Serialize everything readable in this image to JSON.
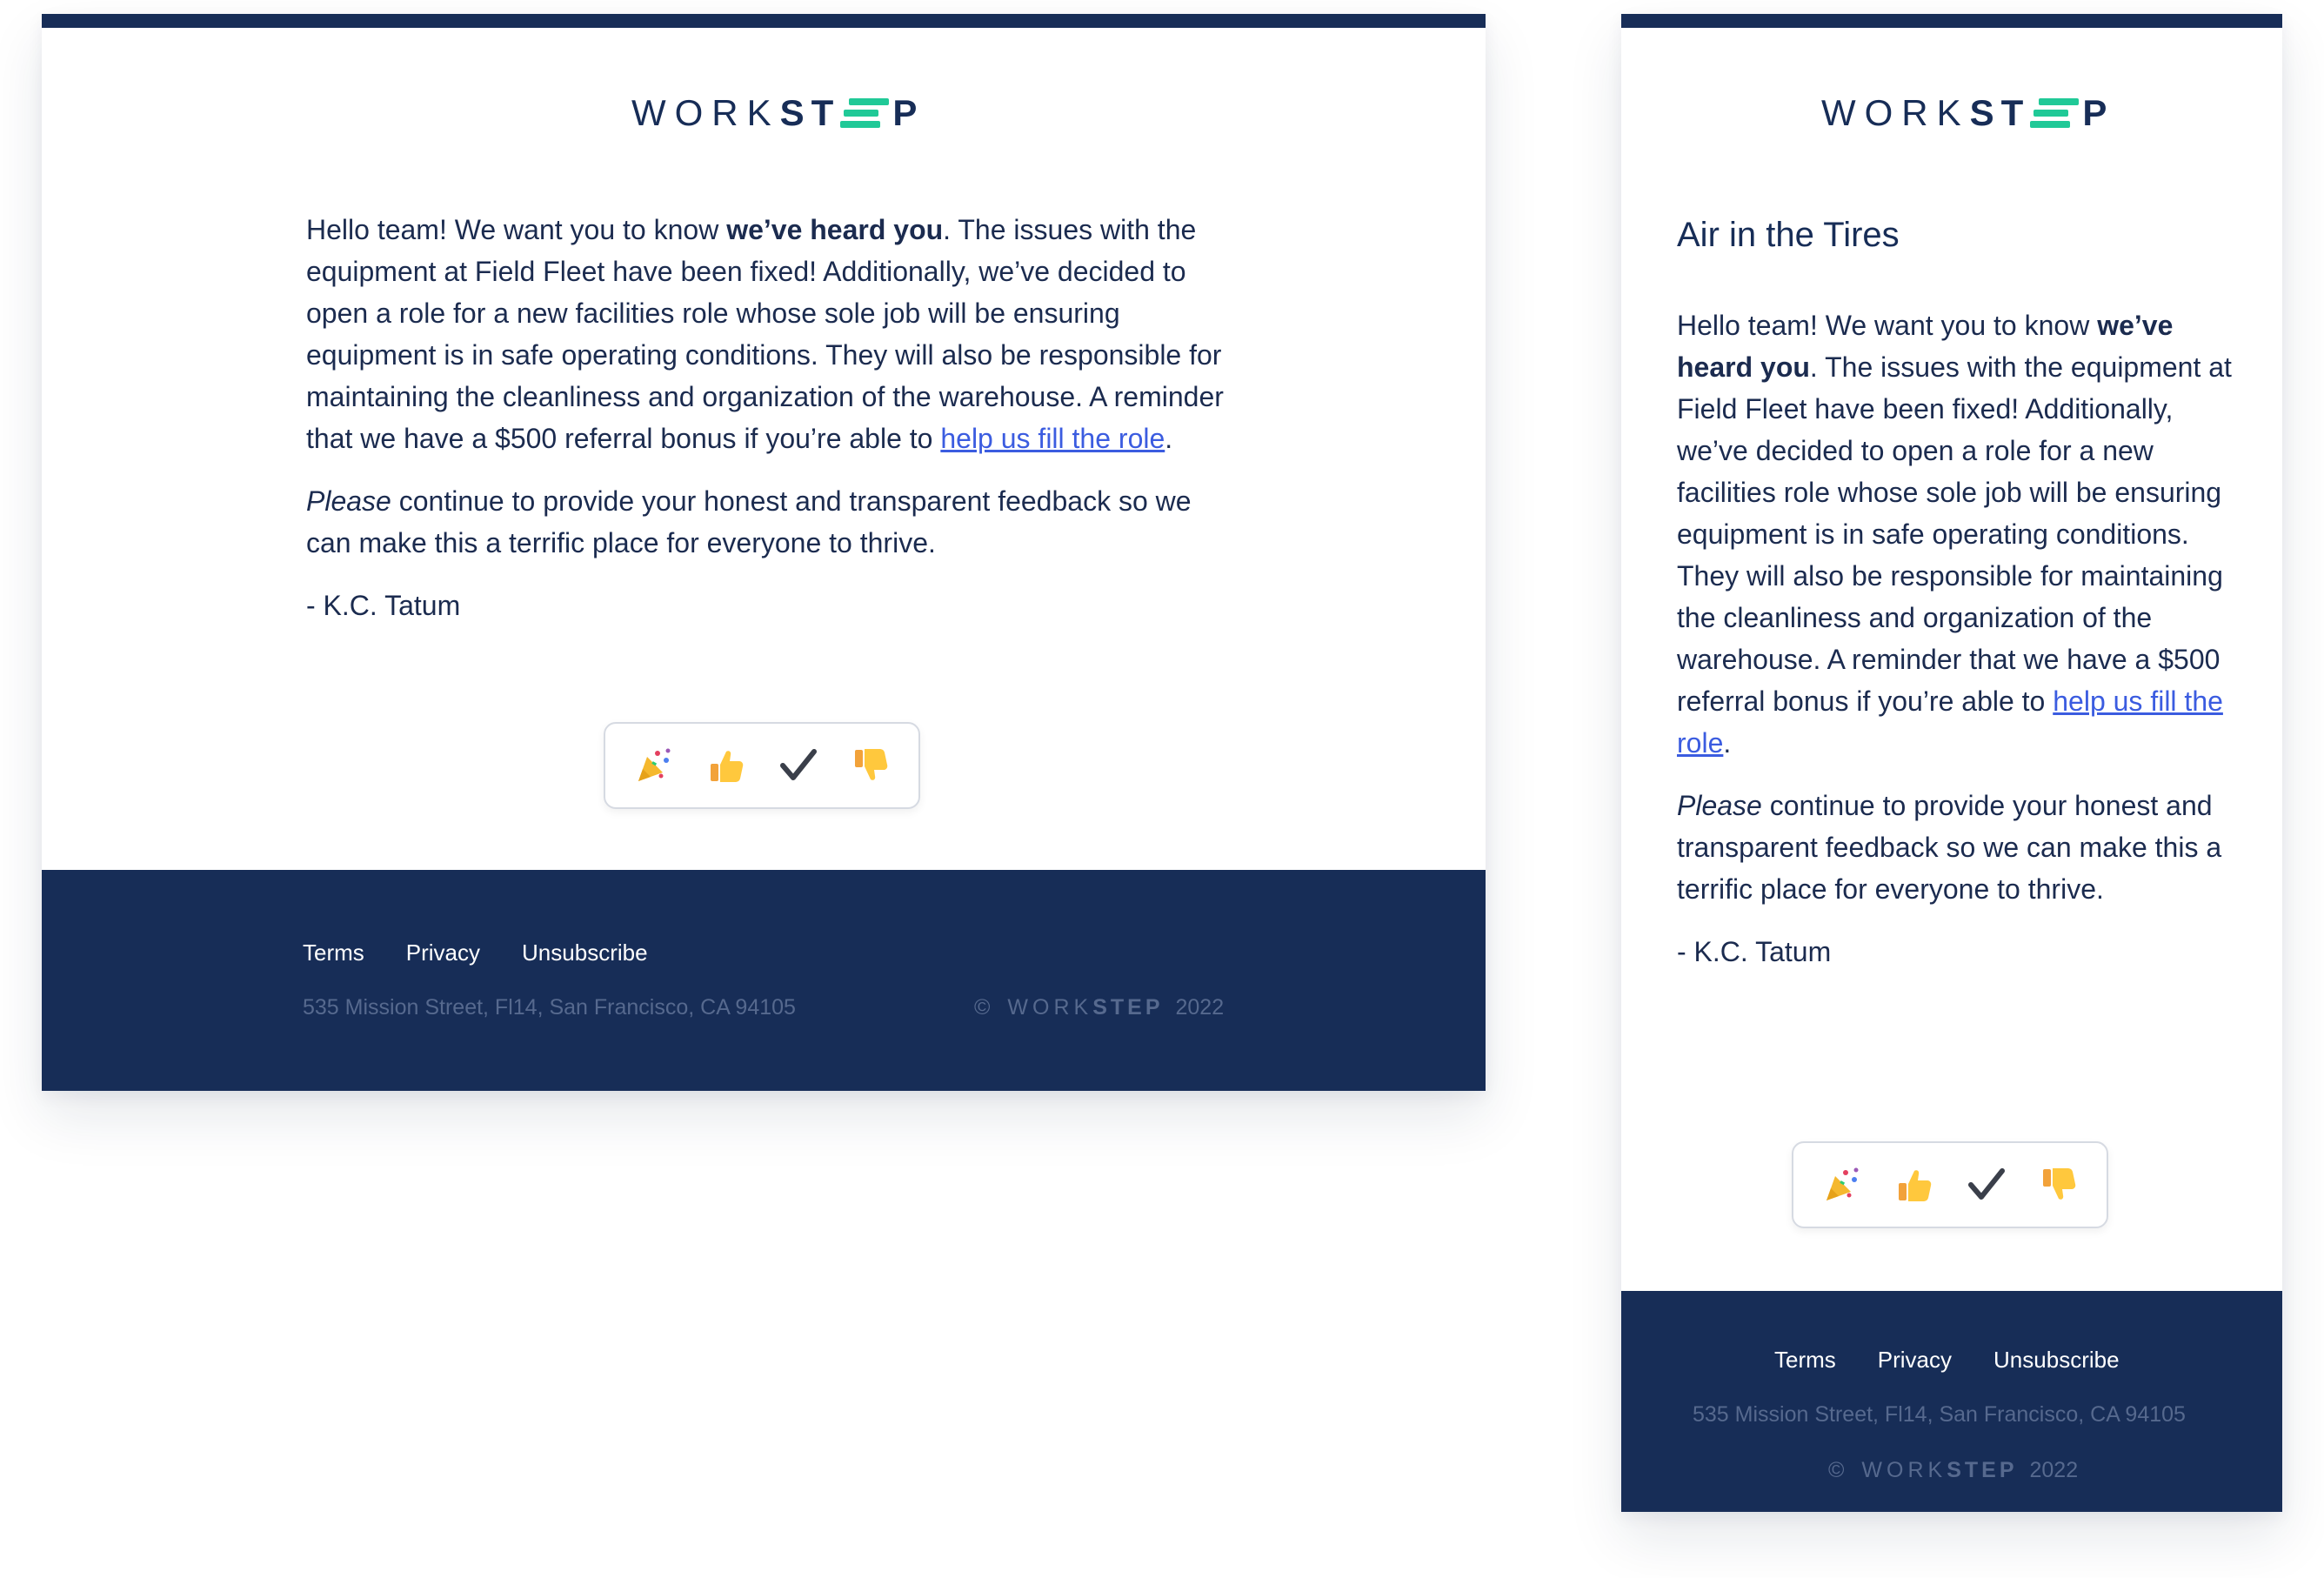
{
  "brand": {
    "logo_word_light": "WORK",
    "logo_word_bold": "ST",
    "logo_word_end": "P",
    "navy": "#172d57",
    "accent_green": "#20c997",
    "link_blue": "#3b5ce0"
  },
  "email": {
    "title": "Air in the Tires",
    "greeting": "Hello team! We want you to know ",
    "greeting_bold": "we’ve heard you",
    "body_1": ". The issues with the equipment at Field Fleet have been fixed! Additionally, we’ve decided to open a role for a new facilities role whose sole job will be ensuring equipment is in safe operating conditions. They will also be responsible for maintaining the cleanliness and organization of the warehouse. A reminder that we have a $500 referral bonus if you’re able to ",
    "link_text": "help us fill the role",
    "body_1_end": ".",
    "please_italic": "Please",
    "body_2": " continue to provide your honest and transparent feedback so we can make this a terrific place for everyone to thrive.",
    "signature": "- K.C. Tatum"
  },
  "reactions": [
    {
      "name": "party-popper-icon",
      "glyph": "🎉"
    },
    {
      "name": "thumbs-up-icon",
      "glyph": "👍"
    },
    {
      "name": "check-mark-icon",
      "glyph": "✓"
    },
    {
      "name": "thumbs-down-icon",
      "glyph": "👎"
    }
  ],
  "footer": {
    "terms": "Terms",
    "privacy": "Privacy",
    "unsubscribe": "Unsubscribe",
    "address": "535 Mission Street, Fl14, San Francisco, CA 94105",
    "copyright_symbol": "©",
    "copyright_word_light": "WORK",
    "copyright_word_bold": "STEP",
    "year": "2022"
  }
}
